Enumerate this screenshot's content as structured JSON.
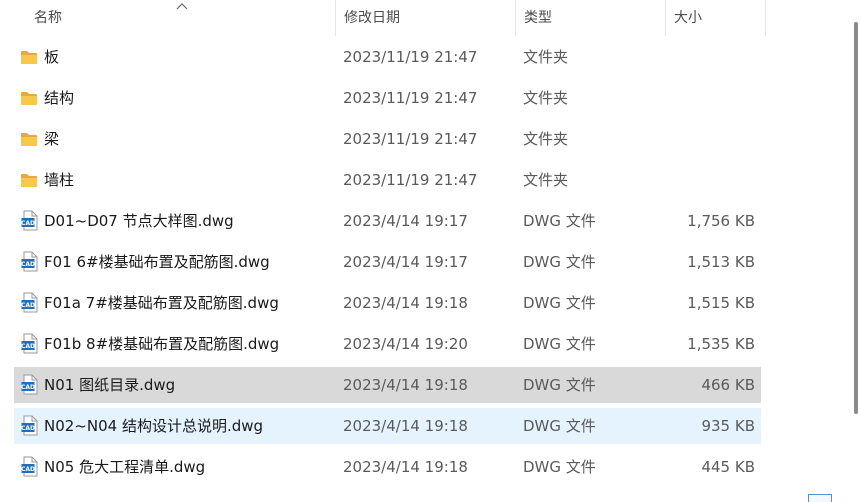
{
  "columns": {
    "name": "名称",
    "date": "修改日期",
    "type": "类型",
    "size": "大小",
    "sort_icon": "chevron-up-icon"
  },
  "files": [
    {
      "name": "板",
      "date": "2023/11/19 21:47",
      "type": "文件夹",
      "size": "",
      "icon": "folder-icon",
      "state": ""
    },
    {
      "name": "结构",
      "date": "2023/11/19 21:47",
      "type": "文件夹",
      "size": "",
      "icon": "folder-icon",
      "state": ""
    },
    {
      "name": "梁",
      "date": "2023/11/19 21:47",
      "type": "文件夹",
      "size": "",
      "icon": "folder-icon",
      "state": ""
    },
    {
      "name": "墙柱",
      "date": "2023/11/19 21:47",
      "type": "文件夹",
      "size": "",
      "icon": "folder-icon",
      "state": ""
    },
    {
      "name": "D01~D07 节点大样图.dwg",
      "date": "2023/4/14 19:17",
      "type": "DWG 文件",
      "size": "1,756 KB",
      "icon": "dwg-file-icon",
      "state": ""
    },
    {
      "name": "F01 6#楼基础布置及配筋图.dwg",
      "date": "2023/4/14 19:17",
      "type": "DWG 文件",
      "size": "1,513 KB",
      "icon": "dwg-file-icon",
      "state": ""
    },
    {
      "name": "F01a 7#楼基础布置及配筋图.dwg",
      "date": "2023/4/14 19:18",
      "type": "DWG 文件",
      "size": "1,515 KB",
      "icon": "dwg-file-icon",
      "state": ""
    },
    {
      "name": "F01b 8#楼基础布置及配筋图.dwg",
      "date": "2023/4/14 19:20",
      "type": "DWG 文件",
      "size": "1,535 KB",
      "icon": "dwg-file-icon",
      "state": ""
    },
    {
      "name": "N01 图纸目录.dwg",
      "date": "2023/4/14 19:18",
      "type": "DWG 文件",
      "size": "466 KB",
      "icon": "dwg-file-icon",
      "state": "selected"
    },
    {
      "name": "N02~N04 结构设计总说明.dwg",
      "date": "2023/4/14 19:18",
      "type": "DWG 文件",
      "size": "935 KB",
      "icon": "dwg-file-icon",
      "state": "hover"
    },
    {
      "name": "N05 危大工程清单.dwg",
      "date": "2023/4/14 19:18",
      "type": "DWG 文件",
      "size": "445 KB",
      "icon": "dwg-file-icon",
      "state": ""
    }
  ],
  "colors": {
    "selected_row": "#d9d9d9",
    "hover_row": "#e5f3ff",
    "folder": "#f5c542",
    "dwg_icon": "#1f6fbf"
  },
  "dwg_icon_text": "CAD"
}
